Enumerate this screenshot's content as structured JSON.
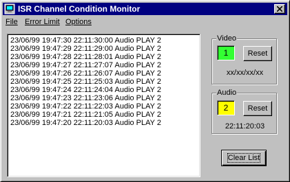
{
  "window": {
    "title": "ISR Channel Condition Monitor"
  },
  "menu": {
    "items": [
      {
        "label": "File"
      },
      {
        "label": "Error Limit"
      },
      {
        "label": "Options"
      }
    ]
  },
  "log": {
    "entries": [
      "23/06/99 19:47:30  22:11:30:00 Audio PLAY 2",
      "23/06/99 19:47:29  22:11:29:00 Audio PLAY 2",
      "23/06/99 19:47:28  22:11:28:01 Audio PLAY 2",
      "23/06/99 19:47:27  22:11:27:07 Audio PLAY 2",
      "23/06/99 19:47:26  22:11:26:07 Audio PLAY 2",
      "23/06/99 19:47:25  22:11:25:03 Audio PLAY 2",
      "23/06/99 19:47:24  22:11:24:04 Audio PLAY 2",
      "23/06/99 19:47:23  22:11:23:06 Audio PLAY 2",
      "23/06/99 19:47:22  22:11:22:03 Audio PLAY 2",
      "23/06/99 19:47:21  22:11:21:05 Audio PLAY 2",
      "23/06/99 19:47:20  22:11:20:03 Audio PLAY 2"
    ]
  },
  "video": {
    "label": "Video",
    "count": "1",
    "indicator_color": "#33ff33",
    "reset_label": "Reset",
    "timecode": "xx/xx/xx/xx"
  },
  "audio": {
    "label": "Audio",
    "count": "2",
    "indicator_color": "#ffff00",
    "reset_label": "Reset",
    "timecode": "22:11:20:03"
  },
  "actions": {
    "clear_label": "Clear List"
  }
}
